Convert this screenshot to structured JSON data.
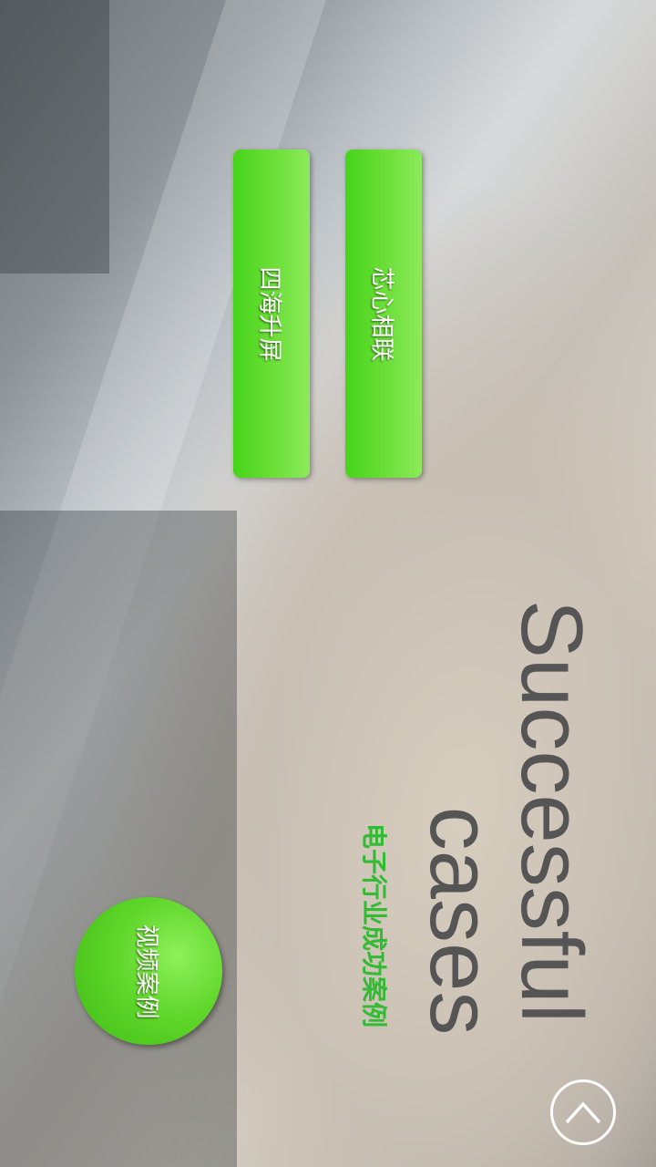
{
  "header": {
    "title_line1": "Successful",
    "title_line2": "cases",
    "subtitle": "电子行业成功案例"
  },
  "menu": {
    "items": [
      {
        "label": "芯心相联"
      },
      {
        "label": "四海升屏"
      }
    ]
  },
  "video_button": {
    "label": "视频案例"
  },
  "nav": {
    "up_icon": "chevron-up-icon"
  },
  "colors": {
    "accent": "#4cd420",
    "subtitle": "#33bb33",
    "title": "#555555"
  }
}
